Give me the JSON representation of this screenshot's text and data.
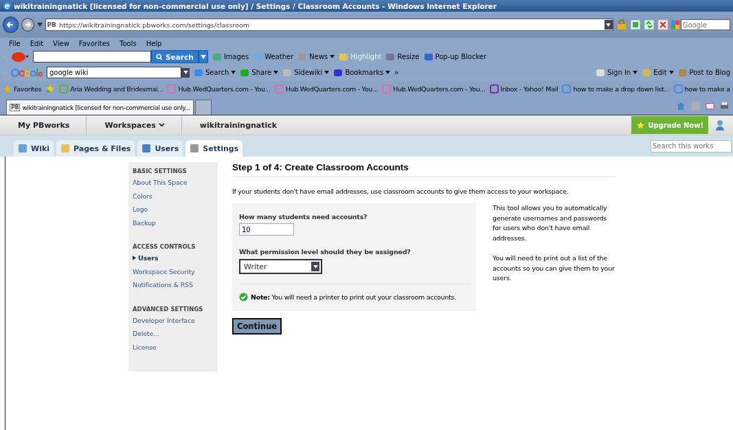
{
  "window": {
    "title": "wikitrainingnatick [licensed for non-commercial use only] / Settings / Classroom Accounts - Windows Internet Explorer"
  },
  "address_bar": {
    "site_badge": "PB",
    "url": "https://wikitrainingnatick.pbworks.com/settings/classroom",
    "search_placeholder": "Google"
  },
  "menu_bar": [
    "File",
    "Edit",
    "View",
    "Favorites",
    "Tools",
    "Help"
  ],
  "ask_toolbar": {
    "search_button": "Search",
    "items": [
      {
        "label": "Images",
        "disabled": false,
        "dropdown": false
      },
      {
        "label": "Weather",
        "disabled": false,
        "dropdown": false
      },
      {
        "label": "News",
        "disabled": false,
        "dropdown": true
      },
      {
        "label": "Highlight",
        "disabled": true,
        "dropdown": false
      },
      {
        "label": "Resize",
        "disabled": false,
        "dropdown": false
      },
      {
        "label": "Pop-up Blocker",
        "disabled": false,
        "dropdown": false
      }
    ]
  },
  "google_toolbar": {
    "query": "google wiki",
    "items": [
      {
        "label": "Search",
        "dropdown": true
      },
      {
        "label": "Share",
        "dropdown": true
      },
      {
        "label": "Sidewiki",
        "dropdown": true
      },
      {
        "label": "Bookmarks",
        "dropdown": true
      },
      {
        "label": "»",
        "dropdown": false
      },
      {
        "label": "Sign In",
        "dropdown": true
      },
      {
        "label": "Edit",
        "dropdown": true
      },
      {
        "label": "Post to Blog",
        "dropdown": false
      }
    ]
  },
  "favorites_bar": {
    "label": "Favorites",
    "items": [
      "Aria Wedding and Bridesmai...",
      "Hub.WedQuarters.com - You...",
      "Hub.WedQuarters.com - You...",
      "Hub.WedQuarters.com - You...",
      "Inbox - Yahoo! Mail",
      "how to make a drop down list...",
      "how to make a"
    ]
  },
  "browser_tabs": [
    {
      "badge": "PB",
      "label": "wikitrainingnatick [licensed for non-commercial use only...",
      "selected": true
    }
  ],
  "site_nav": {
    "items": [
      "My PBworks",
      "Workspaces",
      "wikitrainingnatick"
    ],
    "upgrade_button": "Upgrade Now!"
  },
  "site_tabs": [
    {
      "label": "Wiki",
      "selected": false
    },
    {
      "label": "Pages & Files",
      "selected": false
    },
    {
      "label": "Users",
      "selected": false
    },
    {
      "label": "Settings",
      "selected": true
    }
  ],
  "site_search": {
    "placeholder": "Search this works"
  },
  "sidebar": [
    {
      "heading": "BASIC SETTINGS",
      "items": [
        {
          "label": "About This Space",
          "selected": false
        },
        {
          "label": "Colors",
          "selected": false
        },
        {
          "label": "Logo",
          "selected": false
        },
        {
          "label": "Backup",
          "selected": false
        }
      ]
    },
    {
      "heading": "ACCESS CONTROLS",
      "items": [
        {
          "label": "Users",
          "selected": true
        },
        {
          "label": "Workspace Security",
          "selected": false
        },
        {
          "label": "Notifications & RSS",
          "selected": false
        }
      ]
    },
    {
      "heading": "ADVANCED SETTINGS",
      "items": [
        {
          "label": "Developer Interface",
          "selected": false
        },
        {
          "label": "Delete...",
          "selected": false
        },
        {
          "label": "License",
          "selected": false
        }
      ]
    }
  ],
  "main": {
    "heading": "Step 1 of 4: Create Classroom Accounts",
    "intro": "If your students don't have email addresses, use classroom accounts to give them access to your workspace.",
    "count_label": "How many students need accounts?",
    "count_value": "10",
    "permission_label": "What permission level should they be assigned?",
    "permission_value": "Writer",
    "note": "**Note:** You will need a printer to print out your classroom accounts.",
    "continue_button": "Continue",
    "aside": [
      "This tool allows you to automatically generate usernames and passwords for users who don't have email addresses.",
      "You will need to print out a list of the accounts so you can give them to your users."
    ]
  }
}
